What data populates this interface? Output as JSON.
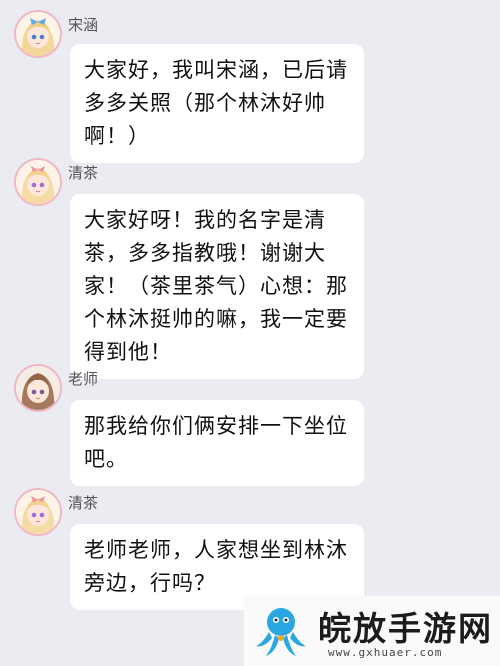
{
  "messages": [
    {
      "sender": "宋涵",
      "avatar_icon": "anime-girl-blonde-bow-avatar",
      "text": "大家好，我叫宋涵，已后请多多关照（那个林沐好帅啊！）"
    },
    {
      "sender": "清茶",
      "avatar_icon": "anime-girl-blonde-pink-ribbon-avatar",
      "text": "大家好呀！我的名字是清茶，多多指教哦！谢谢大家！（茶里茶气）心想：那个林沐挺帅的嘛，我一定要得到他！"
    },
    {
      "sender": "老师",
      "avatar_icon": "anime-girl-brown-hair-avatar",
      "text": "那我给你们俩安排一下坐位吧。"
    },
    {
      "sender": "清茶",
      "avatar_icon": "anime-girl-blonde-pink-ribbon-avatar",
      "text": "老师老师，人家想坐到林沐旁边，行吗？"
    }
  ],
  "watermark": {
    "title": "皖放手游网",
    "url": "www.gxhuaer.com",
    "icon": "octopus-logo-icon"
  },
  "colors": {
    "background": "#ebebf2",
    "bubble": "#ffffff",
    "avatar_border": "#f0b7c4",
    "logo_blue": "#2aa7e0"
  }
}
